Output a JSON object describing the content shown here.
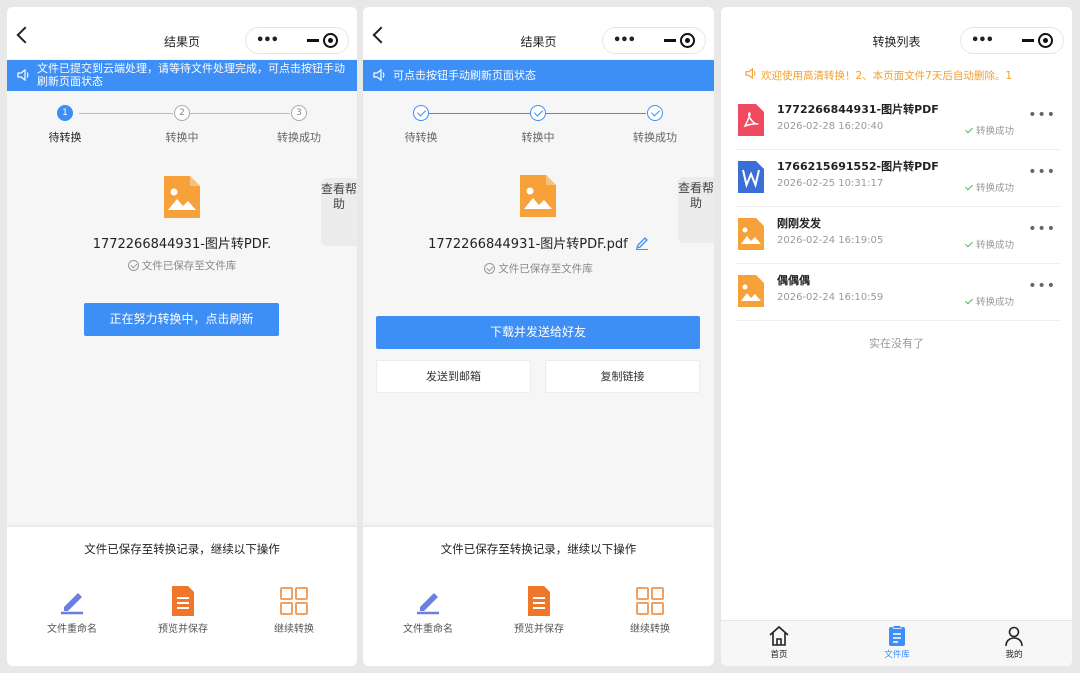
{
  "colors": {
    "accent": "#3d8ef5",
    "warning": "#f0a030",
    "success": "#4cbb5a",
    "image_icon": "#f6a13a",
    "pdf_icon": "#ef4a5f",
    "word_icon": "#3a6fd8",
    "action_orange": "#f0762a"
  },
  "panel1": {
    "nav_title": "结果页",
    "notice": "文件已提交到云端处理，请等待文件处理完成，可点击按钮手动刷新页面状态",
    "steps": [
      {
        "label": "待转换",
        "num": "1"
      },
      {
        "label": "转换中",
        "num": "2"
      },
      {
        "label": "转换成功",
        "num": "3"
      }
    ],
    "help_label": "查看帮助",
    "file_name": "1772266844931-图片转PDF.",
    "saved_text": "文件已保存至文件库",
    "refresh_button": "正在努力转换中，点击刷新",
    "bottom_title": "文件已保存至转换记录，继续以下操作",
    "actions": [
      {
        "label": "文件重命名",
        "icon": "pen-icon"
      },
      {
        "label": "预览并保存",
        "icon": "document-icon"
      },
      {
        "label": "继续转换",
        "icon": "grid-icon"
      }
    ]
  },
  "panel2": {
    "nav_title": "结果页",
    "notice": "可点击按钮手动刷新页面状态",
    "steps": [
      {
        "label": "待转换"
      },
      {
        "label": "转换中"
      },
      {
        "label": "转换成功"
      }
    ],
    "help_label": "查看帮助",
    "file_name": "1772266844931-图片转PDF.pdf",
    "saved_text": "文件已保存至文件库",
    "download_button": "下载并发送给好友",
    "email_button": "发送到邮箱",
    "copy_link_button": "复制链接",
    "bottom_title": "文件已保存至转换记录，继续以下操作",
    "actions": [
      {
        "label": "文件重命名",
        "icon": "pen-icon"
      },
      {
        "label": "预览并保存",
        "icon": "document-icon"
      },
      {
        "label": "继续转换",
        "icon": "grid-icon"
      }
    ]
  },
  "panel3": {
    "nav_title": "转换列表",
    "notice": "欢迎使用高清转换！2、本页面文件7天后自动删除。1",
    "items": [
      {
        "name": "1772266844931-图片转PDF",
        "time": "2026-02-28 16:20:40",
        "status": "转换成功",
        "icon": "pdf-icon"
      },
      {
        "name": "1766215691552-图片转PDF",
        "time": "2026-02-25 10:31:17",
        "status": "转换成功",
        "icon": "word-icon"
      },
      {
        "name": "刚刚发发",
        "time": "2026-02-24 16:19:05",
        "status": "转换成功",
        "icon": "image-icon"
      },
      {
        "name": "偶偶偶",
        "time": "2026-02-24 16:10:59",
        "status": "转换成功",
        "icon": "image-icon"
      }
    ],
    "more_label": "•••",
    "end_text": "实在没有了",
    "tabs": [
      {
        "label": "首页",
        "icon": "home-icon"
      },
      {
        "label": "文件库",
        "icon": "file-library-icon",
        "active": true
      },
      {
        "label": "我的",
        "icon": "user-icon"
      }
    ]
  },
  "capsule": {
    "more_label": "•••"
  }
}
